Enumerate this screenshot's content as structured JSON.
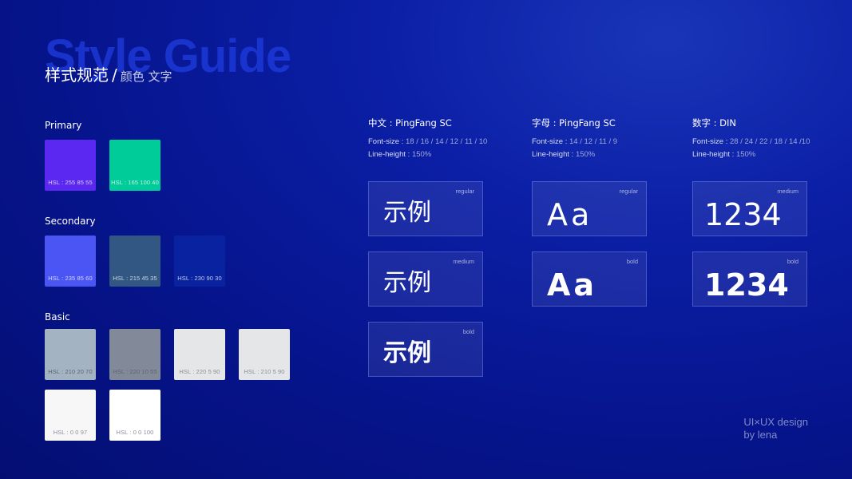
{
  "header": {
    "watermark": "Style Guide",
    "title": "样式规范",
    "slash": "/",
    "subtitle": "颜色 文字"
  },
  "colors": {
    "primary_label": "Primary",
    "secondary_label": "Secondary",
    "basic_label": "Basic",
    "primary": [
      {
        "hsl": "HSL : 255 85 55",
        "color": "#5a28f0"
      },
      {
        "hsl": "HSL : 165 100 40",
        "color": "#00cc99"
      }
    ],
    "secondary": [
      {
        "hsl": "HSL : 235 85 60",
        "color": "#4a55f4"
      },
      {
        "hsl": "HSL : 215 45 35",
        "color": "#315782"
      },
      {
        "hsl": "HSL : 230 90 30",
        "color": "#0822a0"
      }
    ],
    "basic": [
      {
        "hsl": "HSL : 210 20 70",
        "color": "#a3b3c2"
      },
      {
        "hsl": "HSL : 220 10 55",
        "color": "#828a99"
      },
      {
        "hsl": "HSL : 220 5 90",
        "color": "#e5e6e8"
      },
      {
        "hsl": "HSL : 210 5 90",
        "color": "#e4e6e8"
      },
      {
        "hsl": "HSL : 0 0 97",
        "color": "#f7f7f7"
      },
      {
        "hsl": "HSL : 0 0 100",
        "color": "#ffffff"
      }
    ]
  },
  "typography": {
    "font_size_label": "Font-size",
    "line_height_label": "Line-height",
    "columns": [
      {
        "heading": "中文 : PingFang SC",
        "sizes": "18 / 16 / 14 / 12 / 11 / 10",
        "line_height": "150%",
        "sample": "示例",
        "weights": [
          "regular",
          "medium",
          "bold"
        ]
      },
      {
        "heading": "字母 : PingFang SC",
        "sizes": "14 / 12 / 11 / 9",
        "line_height": "150%",
        "sample": "Aa",
        "weights": [
          "regular",
          "bold"
        ]
      },
      {
        "heading": "数字 : DIN",
        "sizes": "28 / 24 / 22 / 18 / 14 /10",
        "line_height": "150%",
        "sample": "1234",
        "weights": [
          "medium",
          "bold"
        ]
      }
    ]
  },
  "credit": {
    "line1": "UI×UX design",
    "line2": "by lena"
  }
}
